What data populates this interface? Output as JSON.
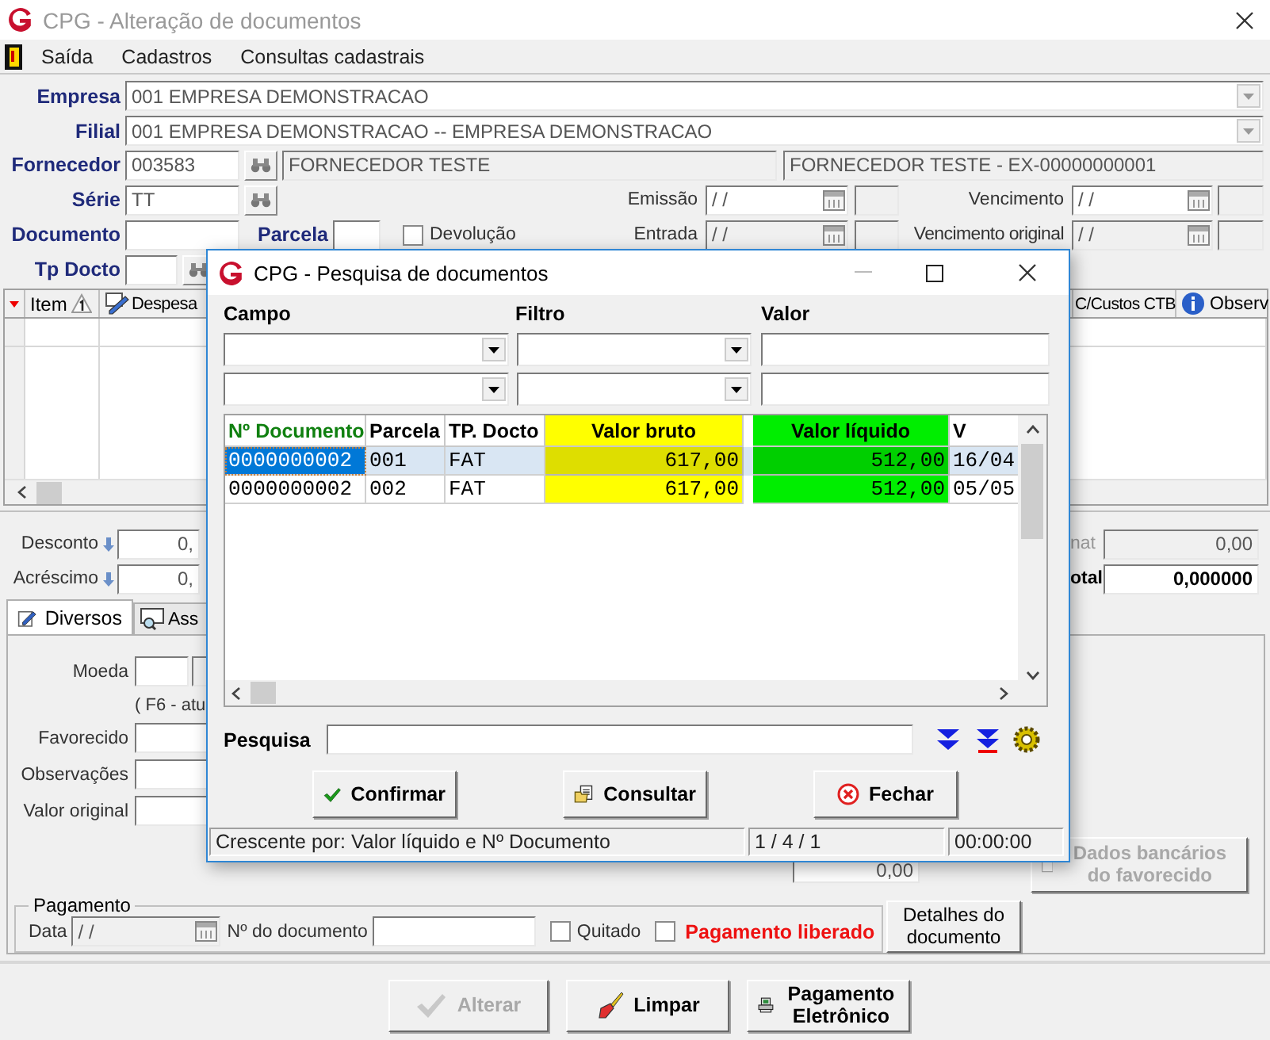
{
  "window": {
    "title": "CPG - Alteração de documentos"
  },
  "menu": [
    "Saída",
    "Cadastros",
    "Consultas cadastrais"
  ],
  "form": {
    "empresa": {
      "label": "Empresa",
      "value": "001 EMPRESA DEMONSTRACAO"
    },
    "filial": {
      "label": "Filial",
      "value": "001 EMPRESA DEMONSTRACAO -- EMPRESA DEMONSTRACAO"
    },
    "fornecedor": {
      "label": "Fornecedor",
      "code": "003583",
      "name": "FORNECEDOR TESTE",
      "full_name": "FORNECEDOR TESTE - EX-00000000001"
    },
    "serie": {
      "label": "Série",
      "value": "TT"
    },
    "documento": {
      "label": "Documento"
    },
    "parcela": {
      "label": "Parcela"
    },
    "devolucao": {
      "label": "Devolução",
      "checked": false
    },
    "tp_docto": {
      "label": "Tp Docto"
    },
    "emissao": {
      "label": "Emissão",
      "value": "/ /"
    },
    "entrada": {
      "label": "Entrada",
      "value": "/ /"
    },
    "vencimento": {
      "label": "Vencimento",
      "value": "/ /"
    },
    "vencimento_original": {
      "label": "Vencimento original",
      "value": "/ /"
    }
  },
  "items_grid": {
    "columns": [
      "Item",
      "Despesa",
      "C/Custos CTB",
      "Observ"
    ]
  },
  "totals": {
    "left": [
      {
        "label": "Desconto",
        "value": "0,"
      },
      {
        "label": "Acréscimo",
        "value": "0,"
      }
    ],
    "right": [
      {
        "label": "nat",
        "value": "0,00",
        "emphasis": false
      },
      {
        "label": "otal",
        "value": "0,000000",
        "emphasis": true
      }
    ]
  },
  "tabs": [
    {
      "label": "Diversos",
      "selected": true
    },
    {
      "label": "Ass",
      "selected": false
    }
  ],
  "diversos": {
    "moeda_label": "Moeda",
    "hint": "( F6 - atu",
    "favorecido_label": "Favorecido",
    "observacoes_label": "Observações",
    "valor_original_label": "Valor original",
    "amount": "0,00",
    "bank_button": {
      "label": "Dados bancários do favorecido",
      "disabled": true
    }
  },
  "pagamento": {
    "title": "Pagamento",
    "data_label": "Data",
    "data_value": "/ /",
    "numero_label": "Nº do documento",
    "quitado": {
      "label": "Quitado",
      "checked": false
    },
    "liberado": {
      "label": "Pagamento liberado",
      "checked": false
    },
    "details_button": "Detalhes do documento"
  },
  "buttons": [
    {
      "label": "Alterar",
      "kind": "check",
      "disabled": true
    },
    {
      "label": "Limpar",
      "kind": "eraser",
      "disabled": false
    },
    {
      "label": "Pagamento Eletrônico",
      "kind": "printer",
      "disabled": false
    }
  ],
  "dialog": {
    "title": "CPG - Pesquisa de documentos",
    "filter_labels": [
      "Campo",
      "Filtro",
      "Valor"
    ],
    "columns": [
      {
        "label": "Nº Documento",
        "sorted": true
      },
      {
        "label": "Parcela",
        "sorted": false
      },
      {
        "label": "TP. Docto",
        "sorted": false
      },
      {
        "label": "Valor bruto",
        "sorted": false,
        "color": "#ffff00"
      },
      {
        "label": "Valor líquido",
        "sorted": false,
        "color": "#00ee00"
      },
      {
        "label": "V",
        "sorted": false
      }
    ],
    "rows": [
      {
        "cells": [
          "0000000002",
          "001",
          "FAT",
          "617,00",
          "512,00",
          "16/04"
        ],
        "selected": true
      },
      {
        "cells": [
          "0000000002",
          "002",
          "FAT",
          "617,00",
          "512,00",
          "05/05"
        ],
        "selected": false
      }
    ],
    "search_label": "Pesquisa",
    "buttons": [
      {
        "label": "Confirmar",
        "kind": "check"
      },
      {
        "label": "Consultar",
        "kind": "folder"
      },
      {
        "label": "Fechar",
        "kind": "close"
      }
    ],
    "status": [
      "Crescente por: Valor líquido e Nº Documento",
      "1 / 4 / 1",
      "00:00:00"
    ]
  }
}
